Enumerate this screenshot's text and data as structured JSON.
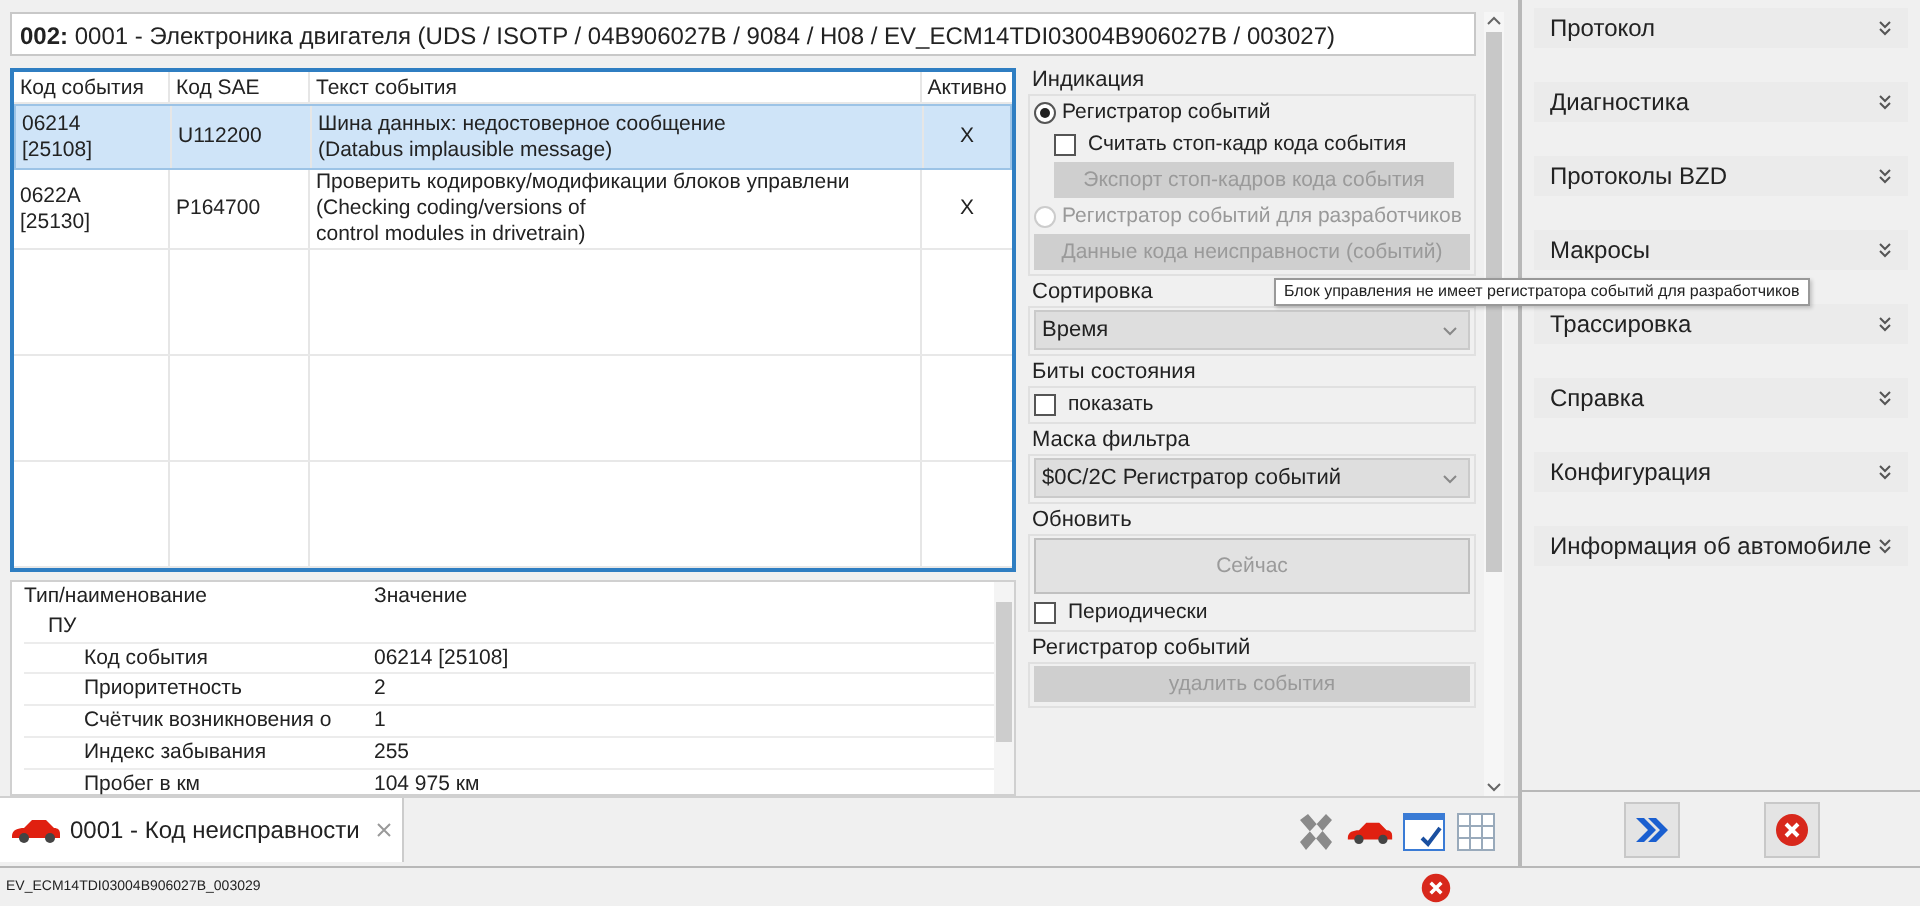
{
  "header": {
    "id": "002:",
    "text": "0001 - Электроника двигателя  (UDS / ISOTP / 04B906027B / 9084 / H08 / EV_ECM14TDI03004B906027B / 003027)"
  },
  "events": {
    "columns": [
      "Код события",
      "Код SAE",
      "Текст события",
      "Активно"
    ],
    "rows": [
      {
        "code": "06214\n[25108]",
        "sae": "U112200",
        "text": "Шина данных: недостоверное сообщение\n(Databus implausible message)",
        "active": "X",
        "selected": true
      },
      {
        "code": "0622A\n[25130]",
        "sae": "P164700",
        "text": "Проверить кодировку/модификации блоков управлени\n(Checking coding/versions of\ncontrol modules in drivetrain)",
        "active": "X",
        "selected": false
      }
    ]
  },
  "details": {
    "columns": [
      "Тип/наименование",
      "Значение"
    ],
    "group": "ПУ",
    "rows": [
      {
        "name": "Код события",
        "value": "06214 [25108]"
      },
      {
        "name": "Приоритетность",
        "value": "2"
      },
      {
        "name": "Счётчик возникновения о",
        "value": "1"
      },
      {
        "name": "Индекс забывания",
        "value": "255"
      },
      {
        "name": "Пробег в км",
        "value": "104 975 км"
      }
    ]
  },
  "options": [
    {
      "legend": "Индикация",
      "items": [
        {
          "kind": "radio",
          "label": "Регистратор событий",
          "selected": true,
          "disabled": false
        },
        {
          "kind": "checkbox",
          "label": "Считать стоп-кадр кода события",
          "checked": false,
          "indent": true
        },
        {
          "kind": "button",
          "label": "Экспорт стоп-кадров кода события",
          "disabled": true,
          "indent": true
        },
        {
          "kind": "radio",
          "label": "Регистратор событий для разработчиков",
          "selected": false,
          "disabled": true
        },
        {
          "kind": "button",
          "label": "Данные кода неисправности (событий)",
          "disabled": true
        }
      ]
    },
    {
      "legend": "Сортировка",
      "items": [
        {
          "kind": "select",
          "value": "Время"
        }
      ]
    },
    {
      "legend": "Биты состояния",
      "items": [
        {
          "kind": "checkbox",
          "label": "показать",
          "checked": false
        }
      ]
    },
    {
      "legend": "Маска фильтра",
      "items": [
        {
          "kind": "select",
          "value": "$0C/2C Регистратор событий"
        }
      ]
    },
    {
      "legend": "Обновить",
      "items": [
        {
          "kind": "button",
          "label": "Сейчас",
          "disabled": true,
          "tall": true
        },
        {
          "kind": "checkbox",
          "label": "Периодически",
          "checked": false
        }
      ]
    },
    {
      "legend": "Регистратор событий",
      "items": [
        {
          "kind": "button",
          "label": "удалить события",
          "disabled": true
        }
      ]
    }
  ],
  "tooltip": "Блок управления не имеет регистратора событий для разработчиков",
  "sidebar": {
    "items": [
      {
        "label": "Протокол"
      },
      {
        "label": "Диагностика"
      },
      {
        "label": "Протоколы BZD"
      },
      {
        "label": "Макросы"
      },
      {
        "label": "Трассировка"
      },
      {
        "label": "Справка"
      },
      {
        "label": "Конфигурация"
      },
      {
        "label": "Информация об автомобиле"
      }
    ]
  },
  "tabs": [
    {
      "label": "0001 - Код неисправности",
      "selected": true
    }
  ],
  "status_bar": {
    "text": "EV_ECM14TDI03004B906027B_003029"
  }
}
